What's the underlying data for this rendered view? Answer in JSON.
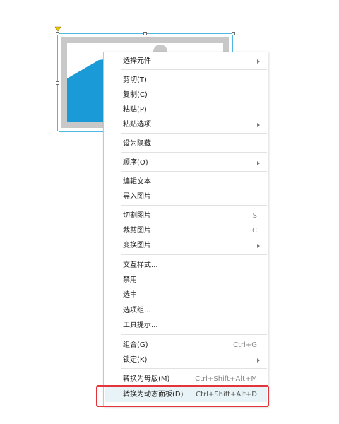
{
  "menu": {
    "items": [
      {
        "label": "选择元件",
        "shortcut": "",
        "submenu": true
      },
      {
        "label": "剪切(T)",
        "shortcut": "",
        "submenu": false
      },
      {
        "label": "复制(C)",
        "shortcut": "",
        "submenu": false
      },
      {
        "label": "粘贴(P)",
        "shortcut": "",
        "submenu": false
      },
      {
        "label": "粘贴选项",
        "shortcut": "",
        "submenu": true
      },
      {
        "label": "设为隐藏",
        "shortcut": "",
        "submenu": false
      },
      {
        "label": "顺序(O)",
        "shortcut": "",
        "submenu": true
      },
      {
        "label": "编辑文本",
        "shortcut": "",
        "submenu": false
      },
      {
        "label": "导入图片",
        "shortcut": "",
        "submenu": false
      },
      {
        "label": "切割图片",
        "shortcut": "S",
        "submenu": false
      },
      {
        "label": "裁剪图片",
        "shortcut": "C",
        "submenu": false
      },
      {
        "label": "变换图片",
        "shortcut": "",
        "submenu": true
      },
      {
        "label": "交互样式...",
        "shortcut": "",
        "submenu": false
      },
      {
        "label": "禁用",
        "shortcut": "",
        "submenu": false
      },
      {
        "label": "选中",
        "shortcut": "",
        "submenu": false
      },
      {
        "label": "选项组...",
        "shortcut": "",
        "submenu": false
      },
      {
        "label": "工具提示...",
        "shortcut": "",
        "submenu": false
      },
      {
        "label": "组合(G)",
        "shortcut": "Ctrl+G",
        "submenu": false
      },
      {
        "label": "锁定(K)",
        "shortcut": "",
        "submenu": true
      },
      {
        "label": "转换为母版(M)",
        "shortcut": "Ctrl+Shift+Alt+M",
        "submenu": false
      },
      {
        "label": "转换为动态面板(D)",
        "shortcut": "Ctrl+Shift+Alt+D",
        "submenu": false
      }
    ],
    "highlighted_item": "转换为动态面板(D)"
  },
  "colors": {
    "selection_border": "#4fb8e0",
    "image_placeholder_fill": "#1a9ad6",
    "highlight_box": "#e5333c",
    "menu_hover": "#e7f3f6"
  },
  "icons": [
    "anchor-triangle-icon",
    "submenu-arrow-icon",
    "image-placeholder-icon"
  ]
}
